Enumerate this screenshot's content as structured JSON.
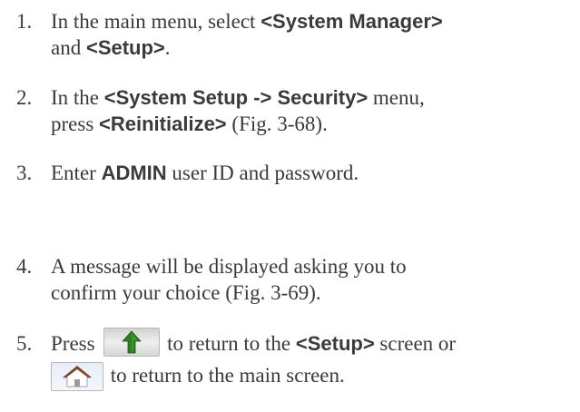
{
  "steps": [
    {
      "number": "1.",
      "line1_a": "In the main menu, select ",
      "line1_b": "<System Manager>",
      "line2_a": "and ",
      "line2_b": "<Setup>",
      "line2_c": "."
    },
    {
      "number": "2.",
      "line1_a": "In the ",
      "line1_b": "<System Setup -> Security>",
      "line1_c": " menu,",
      "line2_a": "press ",
      "line2_b": "<Reinitialize>",
      "line2_c": " (Fig. 3-68)."
    },
    {
      "number": "3.",
      "line1_a": "Enter ",
      "line1_b": "ADMIN",
      "line1_c": " user ID and password."
    },
    {
      "number": "4.",
      "line1": "A message will be displayed asking you to",
      "line2": "confirm your choice (Fig. 3-69)."
    },
    {
      "number": "5.",
      "line1_a": "Press ",
      "line1_icon": "up-arrow-icon",
      "line1_b": " to return to the ",
      "line1_c": "<Setup>",
      "line1_d": " screen or",
      "line2_icon": "home-icon",
      "line2_a": " to return to the main screen."
    }
  ],
  "colors": {
    "text": "#3a3a3a",
    "up_arrow": "#2e7d1e",
    "home_roof": "#7a4a2a"
  }
}
